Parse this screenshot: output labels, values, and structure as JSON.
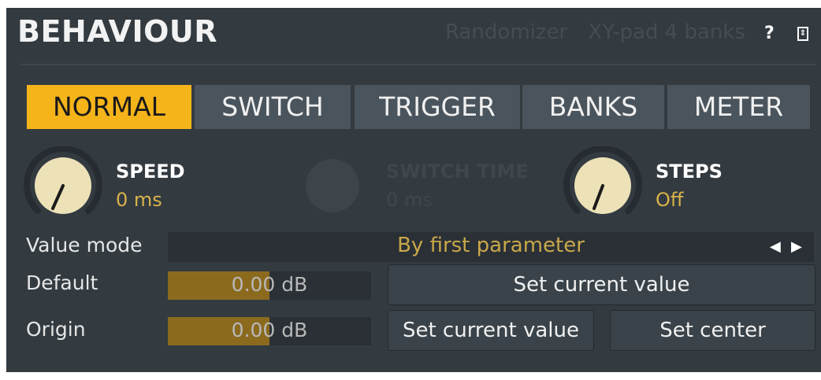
{
  "header": {
    "title": "BEHAVIOUR",
    "links": [
      "Randomizer",
      "XY-pad 4 banks"
    ],
    "help_label": "?"
  },
  "tabs": [
    {
      "label": "NORMAL",
      "active": true
    },
    {
      "label": "SWITCH",
      "active": false
    },
    {
      "label": "TRIGGER",
      "active": false
    },
    {
      "label": "BANKS",
      "active": false
    },
    {
      "label": "METER",
      "active": false
    }
  ],
  "knobs": {
    "speed": {
      "label": "SPEED",
      "value": "0 ms"
    },
    "switch_time": {
      "label": "SWITCH TIME",
      "value": "0 ms"
    },
    "steps": {
      "label": "STEPS",
      "value": "Off"
    }
  },
  "value_mode": {
    "label": "Value mode",
    "value": "By first parameter"
  },
  "default": {
    "label": "Default",
    "value": "0.00 dB",
    "fill_fraction": 0.5,
    "button": "Set current value"
  },
  "origin": {
    "label": "Origin",
    "value": "0.00 dB",
    "fill_fraction": 0.5,
    "button_current": "Set current value",
    "button_center": "Set center"
  },
  "colors": {
    "accent": "#f5b41a",
    "panel": "#333b41",
    "tab": "#4a545c",
    "value_text": "#d9b24a"
  }
}
